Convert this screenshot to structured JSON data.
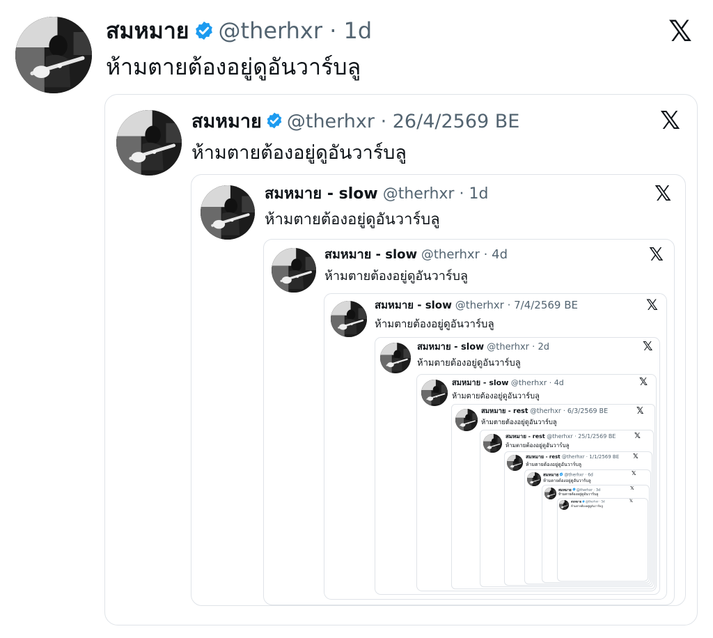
{
  "tweets": [
    {
      "name": "สมหมาย",
      "verified": true,
      "handle": "@therhxr",
      "sep": " · ",
      "date": "1d",
      "text": "ห้ามตายต้องอยู่ดูอันวาร์บลู"
    },
    {
      "name": "สมหมาย",
      "verified": true,
      "handle": "@therhxr",
      "sep": " · ",
      "date": "26/4/2569 BE",
      "text": "ห้ามตายต้องอยู่ดูอันวาร์บลู"
    },
    {
      "name": "สมหมาย - slow",
      "verified": false,
      "handle": "@therhxr",
      "sep": " · ",
      "date": "1d",
      "text": "ห้ามตายต้องอยู่ดูอันวาร์บลู"
    },
    {
      "name": "สมหมาย - slow",
      "verified": false,
      "handle": "@therhxr",
      "sep": " · ",
      "date": "4d",
      "text": "ห้ามตายต้องอยู่ดูอันวาร์บลู"
    },
    {
      "name": "สมหมาย - slow",
      "verified": false,
      "handle": "@therhxr",
      "sep": " · ",
      "date": "7/4/2569 BE",
      "text": "ห้ามตายต้องอยู่ดูอันวาร์บลู"
    },
    {
      "name": "สมหมาย - slow",
      "verified": false,
      "handle": "@therhxr",
      "sep": " · ",
      "date": "2d",
      "text": "ห้ามตายต้องอยู่ดูอันวาร์บลู"
    },
    {
      "name": "สมหมาย - slow",
      "verified": false,
      "handle": "@therhxr",
      "sep": " · ",
      "date": "4d",
      "text": "ห้ามตายต้องอยู่ดูอันวาร์บลู"
    },
    {
      "name": "สมหมาย - rest",
      "verified": false,
      "handle": "@therhxr",
      "sep": " · ",
      "date": "6/3/2569 BE",
      "text": "ห้ามตายต้องอยู่ดูอันวาร์บลู"
    },
    {
      "name": "สมหมาย - rest",
      "verified": false,
      "handle": "@therhxr",
      "sep": " · ",
      "date": "25/1/2569 BE",
      "text": "ห้ามตายต้องอยู่ดูอันวาร์บลู"
    },
    {
      "name": "สมหมาย - rest",
      "verified": false,
      "handle": "@therhxr",
      "sep": " · ",
      "date": "1/1/2569 BE",
      "text": "ห้ามตายต้องอยู่ดูอันวาร์บลู"
    },
    {
      "name": "สมหมาย",
      "verified": true,
      "handle": "@therhxr",
      "sep": " · ",
      "date": "6d",
      "text": "ห้ามตายต้องอยู่ดูอันวาร์บลู"
    },
    {
      "name": "สมหมาย",
      "verified": true,
      "handle": "@therhxr",
      "sep": " · ",
      "date": "3d",
      "text": "ห้ามตายต้องอยู่ดูอันวาร์บลู"
    },
    {
      "name": "สมหมาย",
      "verified": true,
      "handle": "@therhxr",
      "sep": " · ",
      "date": "5d",
      "text": "ห้ามตายต้องอยู่ดูอันวาร์บลู"
    }
  ],
  "x_logo": "𝕏",
  "colors": {
    "verified": "#1d9bf0",
    "border": "#dfe3e8",
    "muted": "#536471",
    "text": "#0f1419"
  },
  "icons": {
    "logo": "x-logo-icon",
    "badge": "verified-badge-icon",
    "avatar": "profile-photo"
  }
}
